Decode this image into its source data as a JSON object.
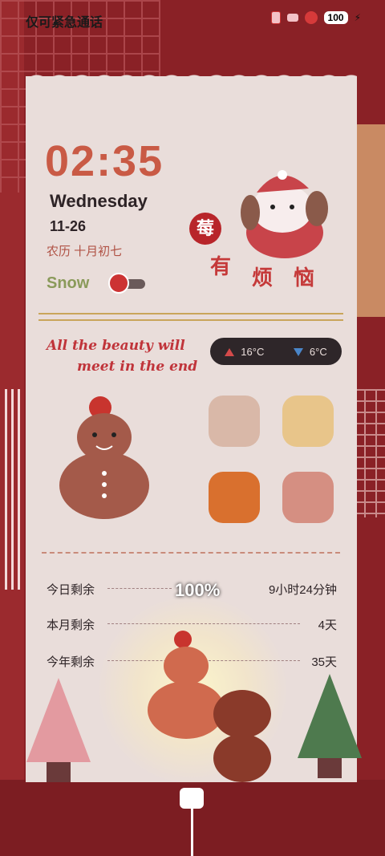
{
  "status_bar": {
    "carrier": "仅可紧急通话",
    "battery": "100"
  },
  "clock": {
    "time": "02:35",
    "weekday": "Wednesday",
    "date": "11-26",
    "lunar": "农历  十月初七"
  },
  "toggle": {
    "label": "Snow"
  },
  "badge": {
    "text": "莓"
  },
  "mood": {
    "chars": [
      "有",
      "烦",
      "恼"
    ]
  },
  "slogan": {
    "line1": "All the beauty will",
    "line2": "meet in the end"
  },
  "weather": {
    "high": "16°C",
    "low": "6°C"
  },
  "charging": {
    "percent": "100%"
  },
  "remaining": [
    {
      "label": "今日剩余",
      "value": "9小时24分钟"
    },
    {
      "label": "本月剩余",
      "value": "4天"
    },
    {
      "label": "今年剩余",
      "value": "35天"
    }
  ],
  "colors": {
    "background": "#8a2126",
    "card": "#e9ddda",
    "accent": "#c95a45"
  }
}
